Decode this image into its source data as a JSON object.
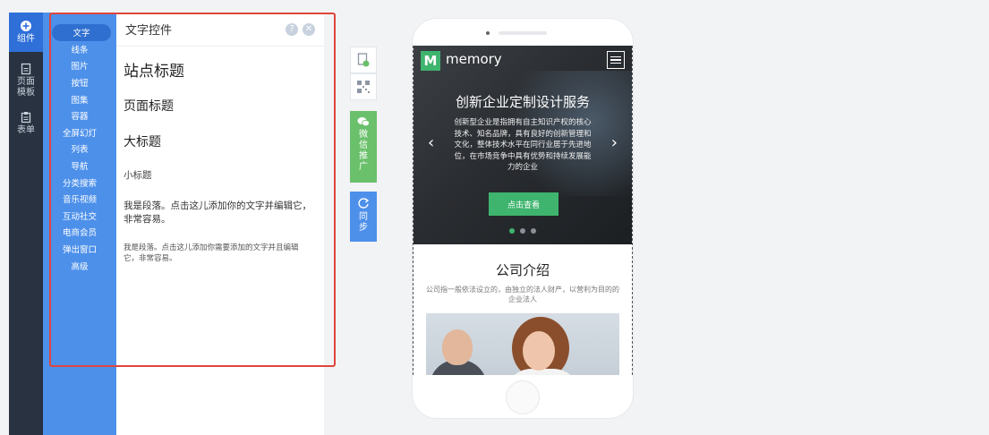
{
  "rail": {
    "items": [
      {
        "label": "组件",
        "icon": "plus-circle-icon"
      },
      {
        "label_lines": [
          "页面",
          "模板"
        ],
        "icon": "page-icon"
      },
      {
        "label": "表单",
        "icon": "clipboard-icon"
      }
    ]
  },
  "categories": [
    "文字",
    "线条",
    "图片",
    "按钮",
    "图集",
    "容器",
    "全屏幻灯",
    "列表",
    "导航",
    "分类搜索",
    "音乐视频",
    "互动社交",
    "电商会员",
    "弹出窗口",
    "高级"
  ],
  "panel": {
    "title": "文字控件",
    "help_icon": "question-icon",
    "close_icon": "close-icon",
    "site_title": "站点标题",
    "page_title": "页面标题",
    "big_title": "大标题",
    "small_title": "小标题",
    "paragraph_1": "我是段落。点击这儿添加你的文字并编辑它，非常容易。",
    "paragraph_2": "我是段落。点击这儿添加你需要添加的文字并且编辑它，非常容易。"
  },
  "tools": {
    "wechat_label": [
      "微",
      "信",
      "推",
      "广"
    ],
    "sync_label": [
      "同",
      "步"
    ]
  },
  "phone": {
    "logo_letter": "M",
    "logo_text": "memory",
    "hero_title": "创新企业定制设计服务",
    "hero_desc": "创新型企业是指拥有自主知识产权的核心技术、知名品牌，具有良好的创新管理和文化，整体技术水平在同行业居于先进地位，在市场竞争中具有优势和持续发展能力的企业",
    "hero_button": "点击查看",
    "slide_count": 3,
    "active_slide": 1,
    "about_title": "公司介绍",
    "about_desc": "公司指一般依法设立的，由独立的法人财产，以营利为目的的企业法人"
  },
  "colors": {
    "accent_blue": "#4d90ea",
    "rail_dark": "#283240",
    "green": "#3fb46e",
    "selection_red": "#e0453c"
  }
}
